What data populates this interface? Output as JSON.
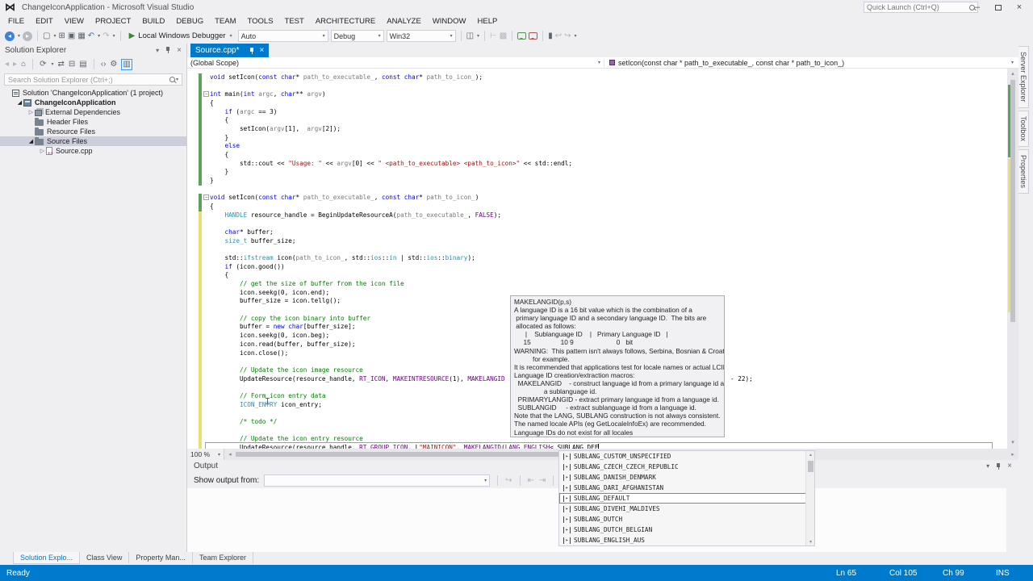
{
  "window": {
    "title": "ChangeIconApplication - Microsoft Visual Studio",
    "quick_launch_placeholder": "Quick Launch (Ctrl+Q)"
  },
  "menus": [
    "FILE",
    "EDIT",
    "VIEW",
    "PROJECT",
    "BUILD",
    "DEBUG",
    "TEAM",
    "TOOLS",
    "TEST",
    "ARCHITECTURE",
    "ANALYZE",
    "WINDOW",
    "HELP"
  ],
  "toolbar": {
    "run_label": "Local Windows Debugger",
    "combo_auto": "Auto",
    "combo_config": "Debug",
    "combo_platform": "Win32"
  },
  "editor_tab": {
    "label": "Source.cpp*"
  },
  "navbar": {
    "scope": "(Global Scope)",
    "member": "setIcon(const char * path_to_executable_, const char * path_to_icon_)"
  },
  "solution_explorer": {
    "title": "Solution Explorer",
    "search_placeholder": "Search Solution Explorer (Ctrl+;)",
    "tree": [
      {
        "icon": "sol",
        "label": "Solution 'ChangeIconApplication' (1 project)",
        "indent": 0,
        "arrow": null,
        "bold": false,
        "selected": false
      },
      {
        "icon": "proj",
        "label": "ChangeIconApplication",
        "indent": 1,
        "arrow": "exp",
        "bold": true,
        "selected": false
      },
      {
        "icon": "ext",
        "label": "External Dependencies",
        "indent": 2,
        "arrow": "col",
        "bold": false,
        "selected": false
      },
      {
        "icon": "folder",
        "label": "Header Files",
        "indent": 2,
        "arrow": null,
        "bold": false,
        "selected": false
      },
      {
        "icon": "folder",
        "label": "Resource Files",
        "indent": 2,
        "arrow": null,
        "bold": false,
        "selected": false
      },
      {
        "icon": "folder",
        "label": "Source Files",
        "indent": 2,
        "arrow": "exp",
        "bold": false,
        "selected": true
      },
      {
        "icon": "cpp",
        "label": "Source.cpp",
        "indent": 3,
        "arrow": "col",
        "bold": false,
        "selected": false
      }
    ]
  },
  "right_tabs": [
    "Server Explorer",
    "Toolbox",
    "Properties"
  ],
  "code": {
    "lines": [
      {
        "b": "g",
        "t": [
          [
            "k",
            "void "
          ],
          [
            "d",
            "setIcon("
          ],
          [
            "k",
            "const char"
          ],
          [
            "d",
            "* "
          ],
          [
            "g",
            "path_to_executable_"
          ],
          [
            "d",
            ", "
          ],
          [
            "k",
            "const char"
          ],
          [
            "d",
            "* "
          ],
          [
            "g",
            "path_to_icon_"
          ],
          [
            "d",
            ");"
          ]
        ]
      },
      {
        "b": "g",
        "t": []
      },
      {
        "b": "g",
        "f": true,
        "t": [
          [
            "k",
            "int "
          ],
          [
            "d",
            "main("
          ],
          [
            "k",
            "int "
          ],
          [
            "g",
            "argc"
          ],
          [
            "d",
            ", "
          ],
          [
            "k",
            "char"
          ],
          [
            "d",
            "** "
          ],
          [
            "g",
            "argv"
          ],
          [
            "d",
            ")"
          ]
        ]
      },
      {
        "b": "g",
        "t": [
          [
            "d",
            "{"
          ]
        ]
      },
      {
        "b": "g",
        "t": [
          [
            "d",
            "    "
          ],
          [
            "k",
            "if"
          ],
          [
            "d",
            " ("
          ],
          [
            "g",
            "argc"
          ],
          [
            "d",
            " == 3)"
          ]
        ]
      },
      {
        "b": "g",
        "t": [
          [
            "d",
            "    {"
          ]
        ]
      },
      {
        "b": "g",
        "t": [
          [
            "d",
            "        setIcon("
          ],
          [
            "g",
            "argv"
          ],
          [
            "d",
            "[1],  "
          ],
          [
            "g",
            "argv"
          ],
          [
            "d",
            "[2]);"
          ]
        ]
      },
      {
        "b": "g",
        "t": [
          [
            "d",
            "    }"
          ]
        ]
      },
      {
        "b": "g",
        "t": [
          [
            "d",
            "    "
          ],
          [
            "k",
            "else"
          ]
        ]
      },
      {
        "b": "g",
        "t": [
          [
            "d",
            "    {"
          ]
        ]
      },
      {
        "b": "g",
        "t": [
          [
            "d",
            "        std::cout << "
          ],
          [
            "s",
            "\"Usage: \""
          ],
          [
            "d",
            " << "
          ],
          [
            "g",
            "argv"
          ],
          [
            "d",
            "[0] << "
          ],
          [
            "s",
            "\" <path_to_executable> <path_to_icon>\""
          ],
          [
            "d",
            " << std::endl;"
          ]
        ]
      },
      {
        "b": "g",
        "t": [
          [
            "d",
            "    }"
          ]
        ]
      },
      {
        "b": "g",
        "t": [
          [
            "d",
            "}"
          ]
        ]
      },
      {
        "t": []
      },
      {
        "b": "g",
        "f": true,
        "t": [
          [
            "k",
            "void "
          ],
          [
            "d",
            "setIcon("
          ],
          [
            "k",
            "const char"
          ],
          [
            "d",
            "* "
          ],
          [
            "g",
            "path_to_executable_"
          ],
          [
            "d",
            ", "
          ],
          [
            "k",
            "const char"
          ],
          [
            "d",
            "* "
          ],
          [
            "g",
            "path_to_icon_"
          ],
          [
            "d",
            ")"
          ]
        ]
      },
      {
        "b": "g",
        "t": [
          [
            "d",
            "{"
          ]
        ]
      },
      {
        "b": "y",
        "t": [
          [
            "d",
            "    "
          ],
          [
            "t",
            "HANDLE"
          ],
          [
            "d",
            " resource_handle = BeginUpdateResourceA("
          ],
          [
            "g",
            "path_to_executable_"
          ],
          [
            "d",
            ", "
          ],
          [
            "m",
            "FALSE"
          ],
          [
            "d",
            ");"
          ]
        ]
      },
      {
        "b": "y",
        "t": []
      },
      {
        "b": "y",
        "t": [
          [
            "d",
            "    "
          ],
          [
            "k",
            "char"
          ],
          [
            "d",
            "* buffer;"
          ]
        ]
      },
      {
        "b": "y",
        "t": [
          [
            "d",
            "    "
          ],
          [
            "t",
            "size_t"
          ],
          [
            "d",
            " buffer_size;"
          ]
        ]
      },
      {
        "b": "y",
        "t": []
      },
      {
        "b": "y",
        "t": [
          [
            "d",
            "    std::"
          ],
          [
            "t",
            "ifstream"
          ],
          [
            "d",
            " icon("
          ],
          [
            "g",
            "path_to_icon_"
          ],
          [
            "d",
            ", std::"
          ],
          [
            "t",
            "ios"
          ],
          [
            "d",
            "::"
          ],
          [
            "t",
            "in"
          ],
          [
            "d",
            " | std::"
          ],
          [
            "t",
            "ios"
          ],
          [
            "d",
            "::"
          ],
          [
            "t",
            "binary"
          ],
          [
            "d",
            ");"
          ]
        ]
      },
      {
        "b": "y",
        "t": [
          [
            "d",
            "    "
          ],
          [
            "k",
            "if"
          ],
          [
            "d",
            " (icon.good())"
          ]
        ]
      },
      {
        "b": "y",
        "t": [
          [
            "d",
            "    {"
          ]
        ]
      },
      {
        "b": "y",
        "t": [
          [
            "c",
            "        // get the size of buffer from the icon file"
          ]
        ]
      },
      {
        "b": "y",
        "t": [
          [
            "d",
            "        icon.seekg(0, icon.end);"
          ]
        ]
      },
      {
        "b": "y",
        "t": [
          [
            "d",
            "        buffer_size = icon.tellg();"
          ]
        ]
      },
      {
        "b": "y",
        "t": []
      },
      {
        "b": "y",
        "t": [
          [
            "c",
            "        // copy the icon binary into buffer"
          ]
        ]
      },
      {
        "b": "y",
        "t": [
          [
            "d",
            "        buffer = "
          ],
          [
            "k",
            "new"
          ],
          [
            "d",
            " "
          ],
          [
            "k",
            "char"
          ],
          [
            "d",
            "[buffer_size];"
          ]
        ]
      },
      {
        "b": "y",
        "t": [
          [
            "d",
            "        icon.seekg(0, icon.beg);"
          ]
        ]
      },
      {
        "b": "y",
        "t": [
          [
            "d",
            "        icon.read(buffer, buffer_size);"
          ]
        ]
      },
      {
        "b": "y",
        "t": [
          [
            "d",
            "        icon.close();"
          ]
        ]
      },
      {
        "b": "y",
        "t": []
      },
      {
        "b": "y",
        "t": [
          [
            "c",
            "        // Update the icon image resource"
          ]
        ]
      },
      {
        "b": "y",
        "t": [
          [
            "d",
            "        UpdateResource(resource_handle, "
          ],
          [
            "m",
            "RT_ICON"
          ],
          [
            "d",
            ", "
          ],
          [
            "m",
            "MAKEINTRESOURCE"
          ],
          [
            "d",
            "(1), "
          ],
          [
            "m",
            "MAKELANGID"
          ]
        ]
      },
      {
        "b": "y",
        "t": []
      },
      {
        "b": "y",
        "t": [
          [
            "c",
            "        // Form icon entry data"
          ]
        ]
      },
      {
        "b": "y",
        "t": [
          [
            "d",
            "        "
          ],
          [
            "t",
            "ICON_ENTRY"
          ],
          [
            "d",
            " icon_entry;"
          ]
        ]
      },
      {
        "b": "y",
        "t": []
      },
      {
        "b": "y",
        "t": [
          [
            "c",
            "        /* todo */"
          ]
        ]
      },
      {
        "b": "y",
        "t": []
      },
      {
        "b": "y",
        "t": [
          [
            "c",
            "        // Update the icon entry resource"
          ]
        ]
      },
      {
        "b": "y",
        "box": true,
        "caret": true,
        "t": [
          [
            "d",
            "        UpdateResource(resource_handle, "
          ],
          [
            "m",
            "RT_GROUP_ICON"
          ],
          [
            "d",
            ", L"
          ],
          [
            "s",
            "\"MAINICON\""
          ],
          [
            "d",
            ", "
          ],
          [
            "m",
            "MAKELANGID"
          ],
          [
            "d",
            "("
          ],
          [
            "m",
            "LANG_ENGLISH"
          ],
          [
            "d",
            "< SUBLANG_DEF"
          ]
        ]
      }
    ],
    "hidden_line_tail": "- 22);"
  },
  "tooltip": {
    "lines": [
      "MAKELANGID(p,s)",
      "A language ID is a 16 bit value which is the combination of a",
      " primary language ID and a secondary language ID.  The bits are",
      " allocated as follows:",
      "      |    Sublanguage ID    |   Primary Language ID   |",
      "     15                10 9                       0   bit",
      "WARNING:  This pattern isn't always follows, Serbina, Bosnian & Croation",
      "          for example.",
      "It is recommended that applications test for locale names or actual LCIDs.",
      "Language ID creation/extraction macros:",
      "  MAKELANGID    - construct language id from a primary language id and",
      "                a sublanguage id.",
      "  PRIMARYLANGID - extract primary language id from a language id.",
      "  SUBLANGID     - extract sublanguage id from a language id.",
      "Note that the LANG, SUBLANG construction is not always consistent.",
      "The named locale APIs (eg GetLocaleInfoEx) are recommended.",
      "Language IDs do not exist for all locales"
    ]
  },
  "intellisense": {
    "items": [
      "SUBLANG_CUSTOM_UNSPECIFIED",
      "SUBLANG_CZECH_CZECH_REPUBLIC",
      "SUBLANG_DANISH_DENMARK",
      "SUBLANG_DARI_AFGHANISTAN",
      "SUBLANG_DEFAULT",
      "SUBLANG_DIVEHI_MALDIVES",
      "SUBLANG_DUTCH",
      "SUBLANG_DUTCH_BELGIAN",
      "SUBLANG_ENGLISH_AUS"
    ],
    "selected_index": 4
  },
  "zoom_level": "100 %",
  "output": {
    "title": "Output",
    "show_from_label": "Show output from:",
    "combo_value": ""
  },
  "bottom_tabs": [
    "Solution Explo...",
    "Class View",
    "Property Man...",
    "Team Explorer"
  ],
  "status": {
    "ready": "Ready",
    "line": "Ln 65",
    "column": "Col 105",
    "character": "Ch 99",
    "mode": "INS"
  },
  "colors": {
    "accent": "#007ACC",
    "keyword": "#0000FF",
    "comment": "#008000",
    "string": "#A31515",
    "macro": "#6F008A",
    "type": "#2B91AF"
  }
}
